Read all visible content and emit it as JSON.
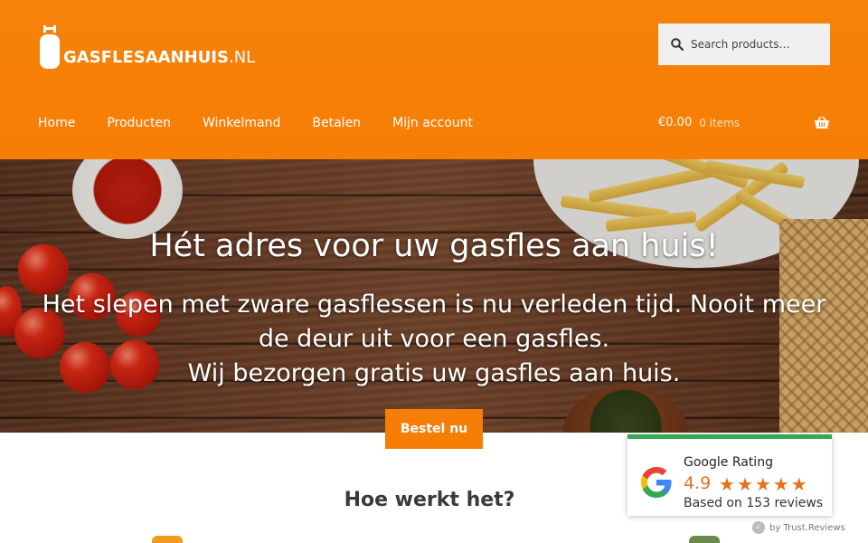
{
  "header": {
    "logo": {
      "bold": "GASFLESAANHUIS",
      "suffix": ".NL"
    },
    "search": {
      "placeholder": "Search products…"
    },
    "nav": [
      "Home",
      "Producten",
      "Winkelmand",
      "Betalen",
      "Mijn account"
    ],
    "cart": {
      "amount": "€0.00",
      "items": "0 items"
    }
  },
  "hero": {
    "title": "Hét adres voor uw gasfles aan huis!",
    "subtitle_lines": [
      "Het slepen met zware gasflessen is nu verleden tijd. Nooit meer",
      "de deur uit voor een gasfles.",
      "Wij bezorgen gratis uw gasfles aan huis."
    ],
    "cta": "Bestel nu"
  },
  "section": {
    "how_title": "Hoe werkt het?"
  },
  "google_rating": {
    "title": "Google Rating",
    "score": "4.9",
    "stars": 5,
    "reviews": "Based on 153 reviews",
    "powered_by": "by Trust.Reviews"
  },
  "colors": {
    "brand_orange": "#f77e05",
    "rating_orange": "#e7711b",
    "rating_bar": "#34a853"
  }
}
